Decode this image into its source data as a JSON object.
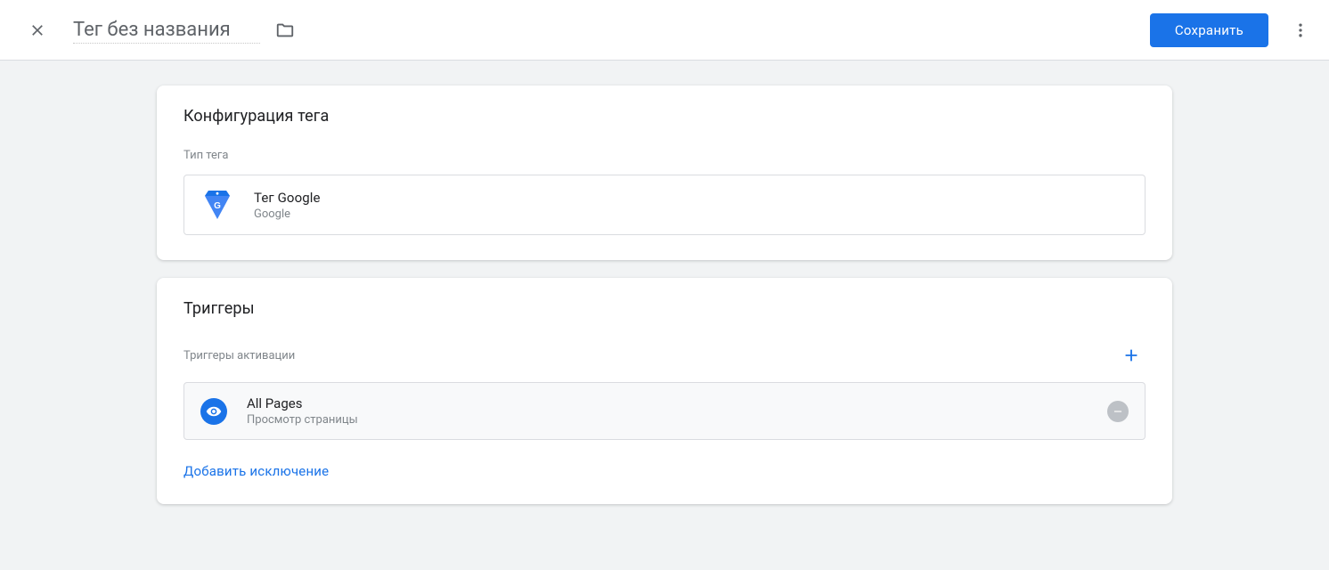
{
  "header": {
    "title_value": "Тег без названия",
    "save_label": "Сохранить"
  },
  "tag_config": {
    "heading": "Конфигурация тега",
    "type_label": "Тип тега",
    "selected": {
      "name": "Тег Google",
      "vendor": "Google"
    }
  },
  "triggers": {
    "heading": "Триггеры",
    "activation_label": "Триггеры активации",
    "items": [
      {
        "name": "All Pages",
        "type": "Просмотр страницы"
      }
    ],
    "add_exception_label": "Добавить исключение"
  }
}
